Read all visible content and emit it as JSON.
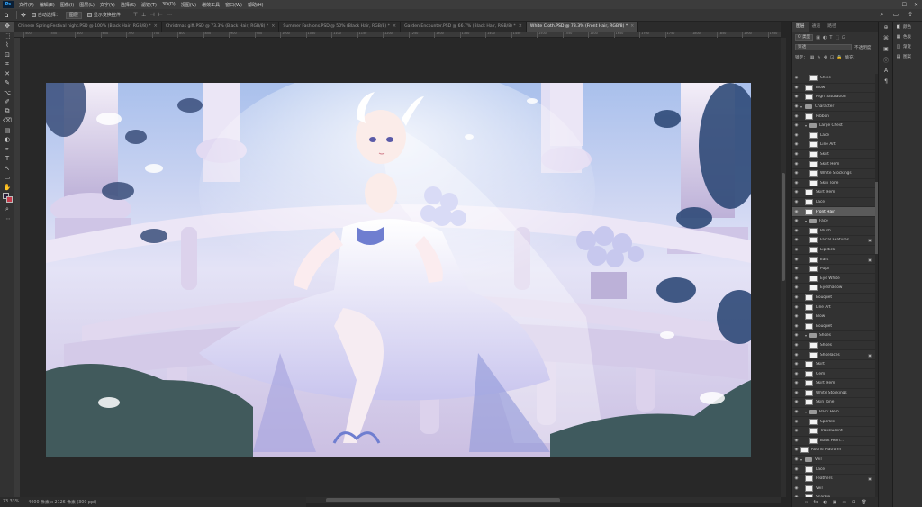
{
  "menubar": {
    "app": "Ps",
    "items": [
      "文件(F)",
      "编辑(E)",
      "图像(I)",
      "图层(L)",
      "文字(Y)",
      "选择(S)",
      "滤镜(T)",
      "3D(D)",
      "视图(V)",
      "增效工具",
      "窗口(W)",
      "帮助(H)"
    ],
    "window_controls": [
      "—",
      "☐",
      "✕"
    ]
  },
  "options": {
    "auto_select_label": "自动选择：",
    "auto_select_value": "图层",
    "transform_label": "显示变换控件",
    "align_icons": [
      "⊤",
      "⊥",
      "⊣",
      "⊢",
      "⋯"
    ],
    "right_icons": [
      "⌕",
      "▭",
      "⇪"
    ]
  },
  "tools": [
    "✥",
    "⬚",
    "⌇",
    "⊡",
    "⌗",
    "✕",
    "✎",
    "⌥",
    "✐",
    "⧉",
    "⌫",
    "▤",
    "◐",
    "✒",
    "T",
    "↖",
    "▭",
    "✋",
    "⌕",
    "⋯"
  ],
  "tabs": [
    {
      "label": "Chinese Spring Festival night.PSD @ 100% (Black Hair, RGB/8) *",
      "active": false
    },
    {
      "label": "Christmas gift.PSD @ 73.3% (Black Hair, RGB/8) *",
      "active": false
    },
    {
      "label": "Summer Fashions.PSD @ 50% (Black Hair, RGB/8) *",
      "active": false
    },
    {
      "label": "Garden Encounter.PSD @ 66.7% (Black Hair, RGB/8) *",
      "active": false
    },
    {
      "label": "White Cloth.PSD @ 73.3% (Front Hair, RGB/8) *",
      "active": true
    }
  ],
  "ruler_ticks": [
    "500",
    "550",
    "600",
    "650",
    "700",
    "750",
    "800",
    "850",
    "900",
    "950",
    "1000",
    "1050",
    "1100",
    "1150",
    "1200",
    "1250",
    "1300",
    "1350",
    "1400",
    "1450",
    "1500",
    "1550",
    "1600",
    "1650",
    "1700",
    "1750",
    "1800",
    "1850",
    "1900",
    "1950"
  ],
  "status": {
    "zoom": "73.33%",
    "doc_info": "4000 像素 x 2126 像素 (300 ppi)"
  },
  "panel": {
    "tabs": [
      "图层",
      "通道",
      "路径"
    ],
    "kind_label": "Q 类型",
    "filter_icons": [
      "▣",
      "◐",
      "T",
      "⬚",
      "⊡"
    ],
    "mode_label": "穿透",
    "opacity_label": "不透明度：",
    "lock_label": "锁定：",
    "lock_icons": [
      "▦",
      "✎",
      "✥",
      "⊡",
      "🔒"
    ],
    "fill_label": "填充：",
    "footer_icons": [
      "∞",
      "fx",
      "◐",
      "▣",
      "▭",
      "⊞",
      "🗑"
    ]
  },
  "layers": [
    {
      "name": "Shine",
      "type": "layer",
      "indent": 2,
      "selected": false,
      "lock": false
    },
    {
      "name": "Blow",
      "type": "layer",
      "indent": 1,
      "selected": false,
      "lock": false
    },
    {
      "name": "High Saturation",
      "type": "layer",
      "indent": 1,
      "selected": false,
      "lock": false
    },
    {
      "name": "Character",
      "type": "group",
      "indent": 0,
      "selected": false,
      "lock": false
    },
    {
      "name": "Ribbon",
      "type": "layer",
      "indent": 1,
      "selected": false,
      "lock": false
    },
    {
      "name": "Large Chest",
      "type": "group",
      "indent": 1,
      "selected": false,
      "lock": false
    },
    {
      "name": "Lace",
      "type": "layer",
      "indent": 2,
      "selected": false,
      "lock": false
    },
    {
      "name": "Line Art",
      "type": "layer",
      "indent": 2,
      "selected": false,
      "lock": false
    },
    {
      "name": "Skirt",
      "type": "layer",
      "indent": 2,
      "selected": false,
      "lock": false
    },
    {
      "name": "Skirt Hem",
      "type": "layer",
      "indent": 2,
      "selected": false,
      "lock": false
    },
    {
      "name": "White Stockings",
      "type": "layer",
      "indent": 2,
      "selected": false,
      "lock": false
    },
    {
      "name": "Skin Tone",
      "type": "layer",
      "indent": 2,
      "selected": false,
      "lock": false
    },
    {
      "name": "Skirt Hem",
      "type": "layer",
      "indent": 1,
      "selected": false,
      "lock": false
    },
    {
      "name": "Lace",
      "type": "layer",
      "indent": 1,
      "selected": false,
      "lock": false
    },
    {
      "name": "Front Hair",
      "type": "layer",
      "indent": 1,
      "selected": true,
      "lock": false
    },
    {
      "name": "Face",
      "type": "group",
      "indent": 1,
      "selected": false,
      "lock": false
    },
    {
      "name": "Blush",
      "type": "layer",
      "indent": 2,
      "selected": false,
      "lock": false
    },
    {
      "name": "Facial Features",
      "type": "layer",
      "indent": 2,
      "selected": false,
      "lock": true
    },
    {
      "name": "Lipstick",
      "type": "layer",
      "indent": 2,
      "selected": false,
      "lock": false
    },
    {
      "name": "Ears",
      "type": "layer",
      "indent": 2,
      "selected": false,
      "lock": true
    },
    {
      "name": "Pupil",
      "type": "layer",
      "indent": 2,
      "selected": false,
      "lock": false
    },
    {
      "name": "Eye White",
      "type": "layer",
      "indent": 2,
      "selected": false,
      "lock": false
    },
    {
      "name": "Eyeshadow",
      "type": "layer",
      "indent": 2,
      "selected": false,
      "lock": false
    },
    {
      "name": "Bouquet",
      "type": "layer",
      "indent": 1,
      "selected": false,
      "lock": false
    },
    {
      "name": "Line Art",
      "type": "layer",
      "indent": 1,
      "selected": false,
      "lock": false
    },
    {
      "name": "Blow",
      "type": "layer",
      "indent": 1,
      "selected": false,
      "lock": false
    },
    {
      "name": "Bouquet",
      "type": "layer",
      "indent": 1,
      "selected": false,
      "lock": false
    },
    {
      "name": "Shoes",
      "type": "group",
      "indent": 1,
      "selected": false,
      "lock": false
    },
    {
      "name": "Shoes",
      "type": "layer",
      "indent": 2,
      "selected": false,
      "lock": false
    },
    {
      "name": "Shoelaces",
      "type": "layer",
      "indent": 2,
      "selected": false,
      "lock": true
    },
    {
      "name": "Skirt",
      "type": "layer",
      "indent": 1,
      "selected": false,
      "lock": false
    },
    {
      "name": "Gem",
      "type": "layer",
      "indent": 1,
      "selected": false,
      "lock": false
    },
    {
      "name": "Skirt Hem",
      "type": "layer",
      "indent": 1,
      "selected": false,
      "lock": false
    },
    {
      "name": "White Stockings",
      "type": "layer",
      "indent": 1,
      "selected": false,
      "lock": false
    },
    {
      "name": "Skin Tone",
      "type": "layer",
      "indent": 1,
      "selected": false,
      "lock": false
    },
    {
      "name": "Back Hem",
      "type": "group",
      "indent": 1,
      "selected": false,
      "lock": false
    },
    {
      "name": "Sparkle",
      "type": "layer",
      "indent": 2,
      "selected": false,
      "lock": false
    },
    {
      "name": "Translucent",
      "type": "layer",
      "indent": 2,
      "selected": false,
      "lock": false
    },
    {
      "name": "Back Hem...",
      "type": "layer",
      "indent": 2,
      "selected": false,
      "lock": false
    },
    {
      "name": "Round Platform",
      "type": "layer",
      "indent": 0,
      "selected": false,
      "lock": false
    },
    {
      "name": "Veil",
      "type": "group",
      "indent": 0,
      "selected": false,
      "lock": false
    },
    {
      "name": "Lace",
      "type": "layer",
      "indent": 1,
      "selected": false,
      "lock": false
    },
    {
      "name": "Feathers",
      "type": "layer",
      "indent": 1,
      "selected": false,
      "lock": true
    },
    {
      "name": "Veil",
      "type": "layer",
      "indent": 1,
      "selected": false,
      "lock": false
    },
    {
      "name": "Sparkle",
      "type": "layer",
      "indent": 1,
      "selected": false,
      "lock": false
    }
  ],
  "dock": [
    {
      "icon": "◧",
      "label": "颜色"
    },
    {
      "icon": "▦",
      "label": "色板"
    },
    {
      "icon": "◫",
      "label": "渐变"
    },
    {
      "icon": "▤",
      "label": "图案"
    }
  ],
  "dock_strip": [
    "⊕",
    "⌘",
    "▣",
    "ⓘ",
    "A",
    "¶"
  ]
}
